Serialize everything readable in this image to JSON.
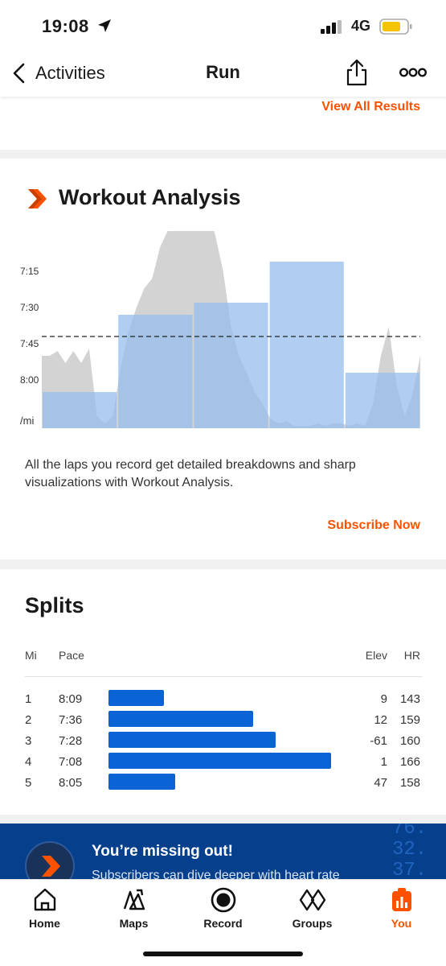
{
  "status_bar": {
    "time": "19:08",
    "network": "4G"
  },
  "nav": {
    "back_label": "Activities",
    "title": "Run"
  },
  "results": {
    "view_all_label": "View All Results"
  },
  "workout_analysis": {
    "title": "Workout Analysis",
    "description": "All the laps you record get detailed breakdowns and sharp visualizations with Workout Analysis.",
    "subscribe_label": "Subscribe Now"
  },
  "chart_data": {
    "type": "bar",
    "y_tick_labels": [
      "7:15",
      "7:30",
      "7:45",
      "8:00"
    ],
    "y_unit_label": "/mi",
    "y_range_sec_per_mi": [
      420,
      500
    ],
    "y_direction": "faster pace is higher",
    "reference_line_pace": "7:42",
    "laps": [
      {
        "pace": "8:05",
        "distance_share": 1
      },
      {
        "pace": "7:33",
        "distance_share": 1
      },
      {
        "pace": "7:28",
        "distance_share": 1
      },
      {
        "pace": "7:11",
        "distance_share": 1
      },
      {
        "pace": "7:57",
        "distance_share": 1
      }
    ],
    "pace_trace_sec_per_mi": [
      470,
      470,
      468,
      473,
      468,
      473,
      467,
      495,
      498,
      495,
      475,
      460,
      450,
      442,
      438,
      425,
      418,
      412,
      405,
      405,
      405,
      410,
      420,
      435,
      458,
      470,
      477,
      485,
      490,
      496,
      498,
      497,
      499,
      499,
      499,
      498,
      499,
      498,
      498,
      499,
      498,
      499,
      490,
      470,
      458,
      482,
      495,
      486,
      470
    ],
    "colors": {
      "lap_bar": "#94bdee",
      "pace_area": "#d3d3d3",
      "overlap": "#7d9cc4"
    }
  },
  "splits": {
    "title": "Splits",
    "headers": {
      "mi": "Mi",
      "pace": "Pace",
      "elev": "Elev",
      "hr": "HR"
    },
    "rows": [
      {
        "mi": "1",
        "pace": "8:09",
        "elev": "9",
        "hr": "143",
        "bar_fraction": 0.25
      },
      {
        "mi": "2",
        "pace": "7:36",
        "elev": "12",
        "hr": "159",
        "bar_fraction": 0.65
      },
      {
        "mi": "3",
        "pace": "7:28",
        "elev": "-61",
        "hr": "160",
        "bar_fraction": 0.75
      },
      {
        "mi": "4",
        "pace": "7:08",
        "elev": "1",
        "hr": "166",
        "bar_fraction": 1.0
      },
      {
        "mi": "5",
        "pace": "8:05",
        "elev": "47",
        "hr": "158",
        "bar_fraction": 0.3
      }
    ],
    "bar_color": "#0a63d4"
  },
  "promo": {
    "title": "You’re missing out!",
    "subtitle": "Subscribers can dive deeper with heart rate",
    "deco_digits": [
      "76.",
      "32.",
      "37."
    ]
  },
  "tabs": [
    {
      "label": "Home",
      "icon": "home-icon"
    },
    {
      "label": "Maps",
      "icon": "maps-icon"
    },
    {
      "label": "Record",
      "icon": "record-icon"
    },
    {
      "label": "Groups",
      "icon": "groups-icon"
    },
    {
      "label": "You",
      "icon": "you-icon",
      "active": true
    }
  ],
  "colors": {
    "accent": "#fc5200",
    "brand_blue": "#063f8c"
  }
}
